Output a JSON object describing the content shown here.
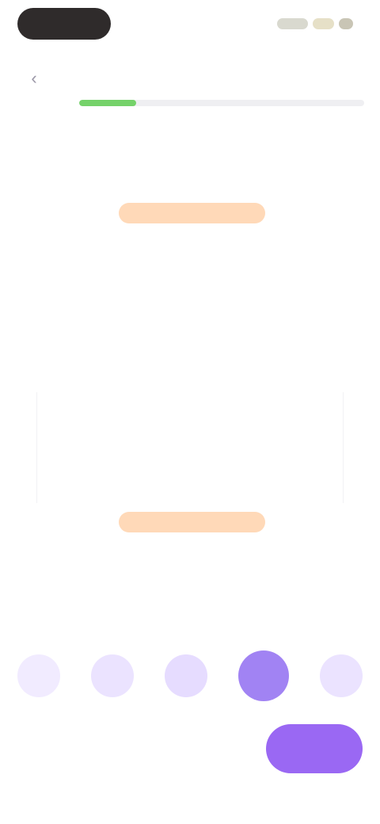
{
  "status_bar": {
    "time": "",
    "icons": [
      "signal-icon",
      "wifi-icon",
      "battery-icon"
    ]
  },
  "header": {
    "back_icon": "chevron-left-icon",
    "breadcrumb": "",
    "progress": 0.2
  },
  "prompt": {
    "question": ""
  },
  "rating": {
    "left_label": "",
    "right_label": "",
    "options": [
      "",
      "",
      "",
      "",
      ""
    ],
    "selected_index": 3
  },
  "footer": {
    "skip_label": "",
    "continue_label": ""
  },
  "colors": {
    "accent": "#9a68f3",
    "progress": "#75d26a",
    "highlight": "#ffd9b8"
  }
}
